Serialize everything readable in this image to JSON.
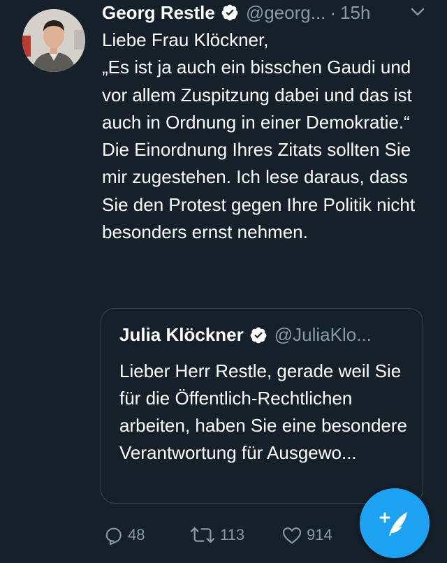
{
  "tweet": {
    "author_name": "Georg Restle",
    "handle": "@georg...",
    "separator": "·",
    "time": "15h",
    "text": "Liebe Frau Klöckner,\n„Es ist ja auch ein bisschen Gaudi und vor allem Zuspitzung dabei und das ist auch in Ordnung in einer Demokratie.“ Die Einordnung Ihres Zitats sollten Sie mir zugestehen. Ich lese daraus, dass Sie den Protest gegen Ihre Politik nicht besonders ernst nehmen."
  },
  "quoted_tweet": {
    "author_name": "Julia Klöckner",
    "handle": "@JuliaKlo...",
    "text": "Lieber Herr Restle, gerade weil Sie für die Öffentlich-Rechtlichen arbeiten, haben Sie eine besondere Verantwortung für Ausgewo..."
  },
  "actions": {
    "reply_count": "48",
    "retweet_count": "113",
    "like_count": "914"
  },
  "icons": {
    "reply": "reply-icon",
    "retweet": "retweet-icon",
    "like": "heart-icon",
    "verified": "verified-badge-icon",
    "more": "chevron-down-icon",
    "compose": "compose-tweet-icon"
  },
  "colors": {
    "background": "#15202b",
    "text": "#ffffff",
    "secondary_text": "#8899a6",
    "border": "#38444d",
    "accent": "#1da1f2"
  }
}
